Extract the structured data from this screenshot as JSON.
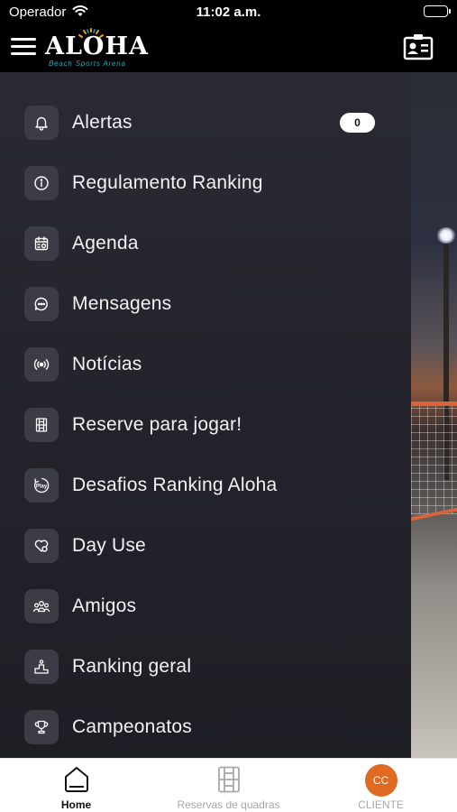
{
  "status_bar": {
    "carrier": "Operador",
    "time": "11:02 a.m.",
    "battery_level": 1.0
  },
  "header": {
    "logo_text": "ALOHA",
    "logo_subtitle": "Beach Sports Arena",
    "icons": [
      "menu-icon",
      "contact-card-icon"
    ]
  },
  "menu": {
    "items": [
      {
        "label": "Alertas",
        "icon": "bell-icon",
        "badge": "0"
      },
      {
        "label": "Regulamento Ranking",
        "icon": "info-icon"
      },
      {
        "label": "Agenda",
        "icon": "calendar-icon"
      },
      {
        "label": "Mensagens",
        "icon": "chat-icon"
      },
      {
        "label": "Notícias",
        "icon": "broadcast-icon"
      },
      {
        "label": "Reserve para jogar!",
        "icon": "court-icon"
      },
      {
        "label": "Desafios Ranking Aloha",
        "icon": "play-icon"
      },
      {
        "label": "Day Use",
        "icon": "heart-icon"
      },
      {
        "label": "Amigos",
        "icon": "friends-icon"
      },
      {
        "label": "Ranking geral",
        "icon": "podium-icon"
      },
      {
        "label": "Campeonatos",
        "icon": "trophy-icon"
      }
    ]
  },
  "tabbar": {
    "tabs": [
      {
        "label": "Home",
        "icon": "home-icon",
        "active": true
      },
      {
        "label": "Reservas de quadras",
        "icon": "court-icon",
        "active": false
      },
      {
        "label": "CLIENTE",
        "avatar_initials": "CC",
        "active": false
      }
    ]
  },
  "colors": {
    "drawer_bg": "#26262f",
    "icon_box": "#3b3c45",
    "avatar": "#e06a22",
    "tab_active": "#111111",
    "tab_inactive": "#a8a8a8"
  }
}
